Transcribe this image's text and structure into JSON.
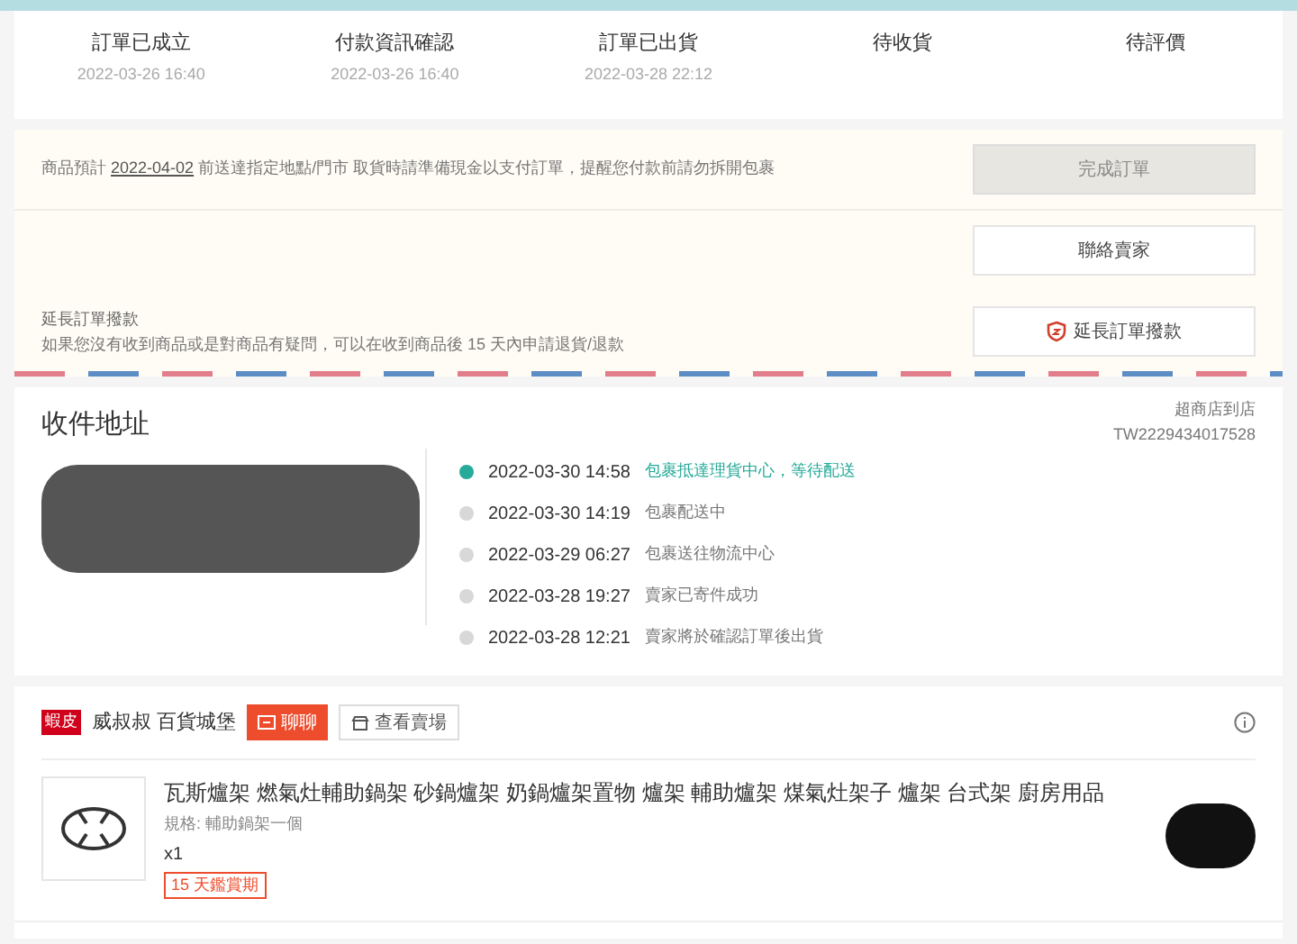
{
  "steps": [
    {
      "label": "訂單已成立",
      "time": "2022-03-26 16:40"
    },
    {
      "label": "付款資訊確認",
      "time": "2022-03-26 16:40"
    },
    {
      "label": "訂單已出貨",
      "time": "2022-03-28 22:12"
    },
    {
      "label": "待收貨"
    },
    {
      "label": "待評價"
    }
  ],
  "notice": {
    "before": "商品預計",
    "date": "2022-04-02",
    "after": "前送達指定地點/門市 取貨時請準備現金以支付訂單，提醒您付款前請勿拆開包裹",
    "button": "完成訂單",
    "button_disabled": true
  },
  "actions": {
    "contact_button": "聯絡賣家",
    "extend_title": "延長訂單撥款",
    "extend_text": "如果您沒有收到商品或是對商品有疑問，可以在收到商品後 15 天內申請退貨/退款",
    "extend_button": "延長訂單撥款"
  },
  "address": {
    "title": "收件地址",
    "carrier": "超商店到店",
    "tracking": "TW2229434017528"
  },
  "timeline": [
    {
      "time": "2022-03-30 14:58",
      "text": "包裹抵達理貨中心，等待配送",
      "active": true
    },
    {
      "time": "2022-03-30 14:19",
      "text": "包裹配送中",
      "active": false
    },
    {
      "time": "2022-03-29 06:27",
      "text": "包裹送往物流中心",
      "active": false
    },
    {
      "time": "2022-03-28 19:27",
      "text": "賣家已寄件成功",
      "active": false
    },
    {
      "time": "2022-03-28 12:21",
      "text": "賣家將於確認訂單後出貨",
      "active": false
    }
  ],
  "shop": {
    "badge": "蝦皮",
    "name": "威叔叔 百貨城堡",
    "chat_button": "聊聊",
    "view_button": "查看賣場"
  },
  "product": {
    "title": "瓦斯爐架 燃氣灶輔助鍋架 砂鍋爐架 奶鍋爐架置物 爐架 輔助爐架 煤氣灶架子 爐架 台式架 廚房用品",
    "spec": "規格: 輔助鍋架一個",
    "qty": "x1",
    "tag": "15 天鑑賞期"
  }
}
